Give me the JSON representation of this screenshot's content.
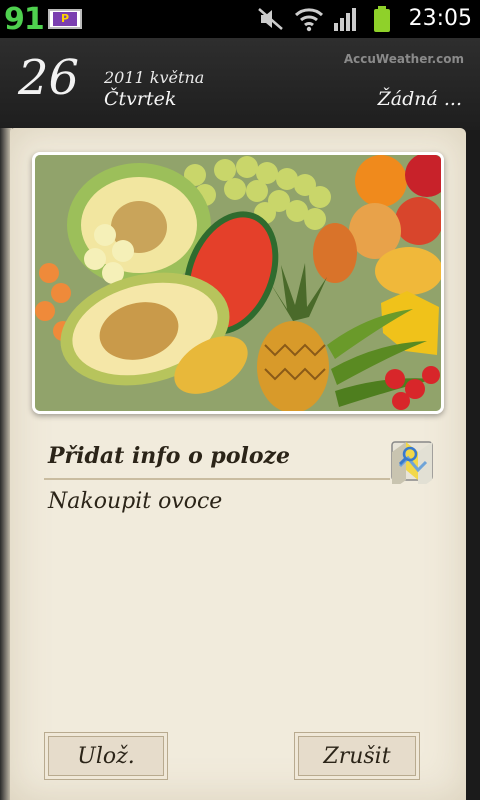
{
  "status_bar": {
    "notification_number": "91",
    "parking_label": "P",
    "time": "23:05"
  },
  "header": {
    "day": "26",
    "year_month": "2011 května",
    "weekday": "Čtvrtek",
    "weather_link": "Žádná ...",
    "provider": "AccuWeather.com"
  },
  "event": {
    "location_title": "Přidat info o poloze",
    "note": "Nakoupit ovoce"
  },
  "buttons": {
    "save": "Ulož.",
    "cancel": "Zrušit"
  }
}
